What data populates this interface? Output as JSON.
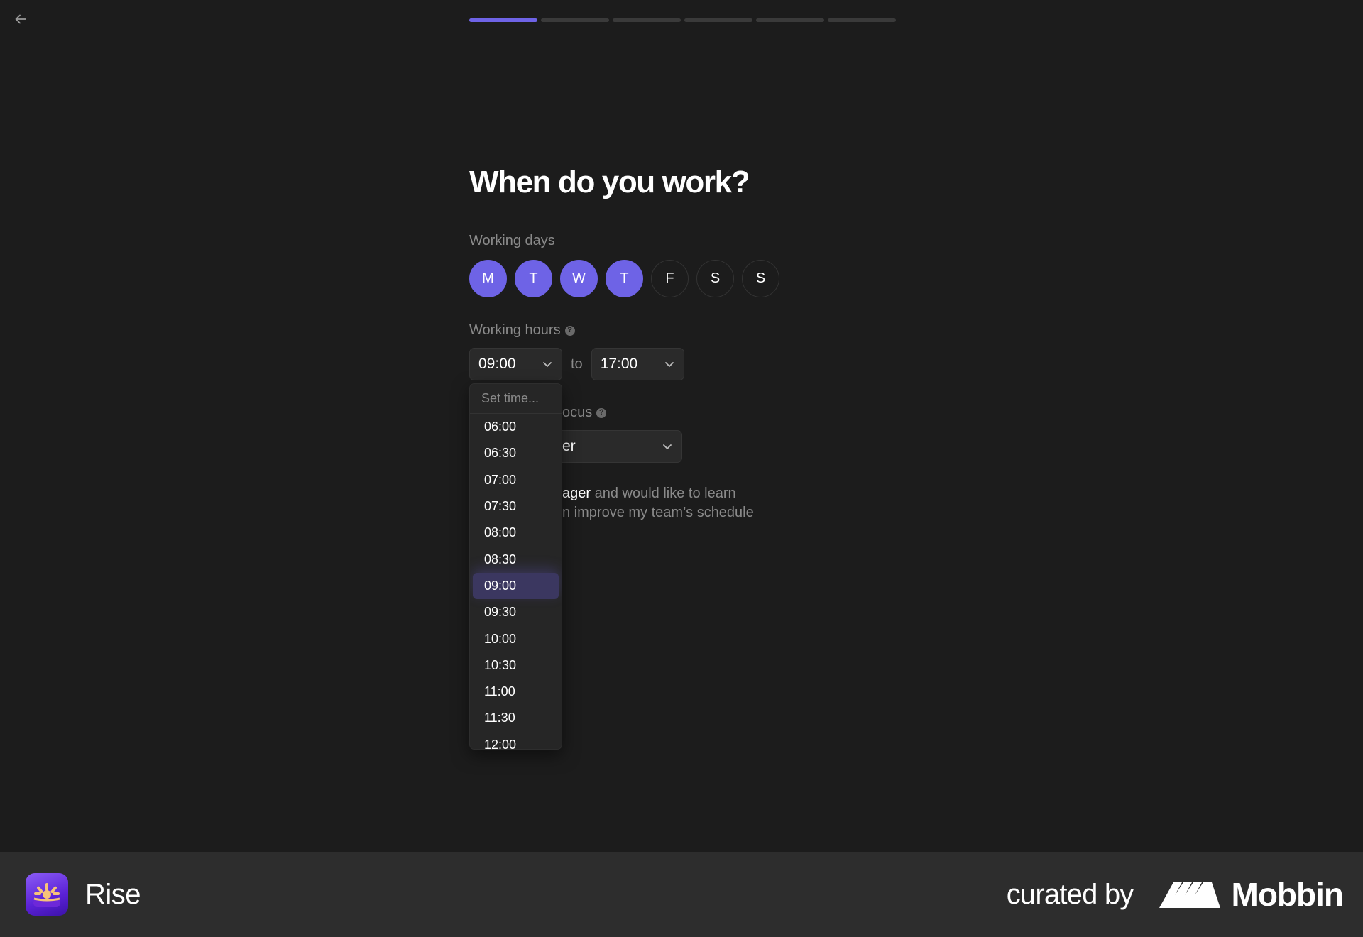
{
  "progress": {
    "total_steps": 6,
    "current_step": 1
  },
  "page": {
    "title": "When do you work?",
    "working_days_label": "Working days",
    "working_hours_label": "Working hours",
    "work_focus_label_partial": "ocus",
    "to_label": "to",
    "role_value_partial": "er",
    "manager_text": {
      "strong": "ager",
      "rest_line1": " and would like to learn",
      "line2": "n improve my team’s schedule"
    }
  },
  "days": [
    {
      "label": "M",
      "selected": true
    },
    {
      "label": "T",
      "selected": true
    },
    {
      "label": "W",
      "selected": true
    },
    {
      "label": "T",
      "selected": true
    },
    {
      "label": "F",
      "selected": false
    },
    {
      "label": "S",
      "selected": false
    },
    {
      "label": "S",
      "selected": false
    }
  ],
  "hours": {
    "start": "09:00",
    "end": "17:00"
  },
  "dropdown": {
    "placeholder": "Set time...",
    "options": [
      "06:00",
      "06:30",
      "07:00",
      "07:30",
      "08:00",
      "08:30",
      "09:00",
      "09:30",
      "10:00",
      "10:30",
      "11:00",
      "11:30",
      "12:00"
    ],
    "selected": "09:00"
  },
  "footer": {
    "app_name": "Rise",
    "curated_by": "curated by",
    "brand": "Mobbin"
  },
  "colors": {
    "accent": "#6e63e6",
    "background": "#1c1c1c",
    "footer_background": "#2d2d2d"
  }
}
